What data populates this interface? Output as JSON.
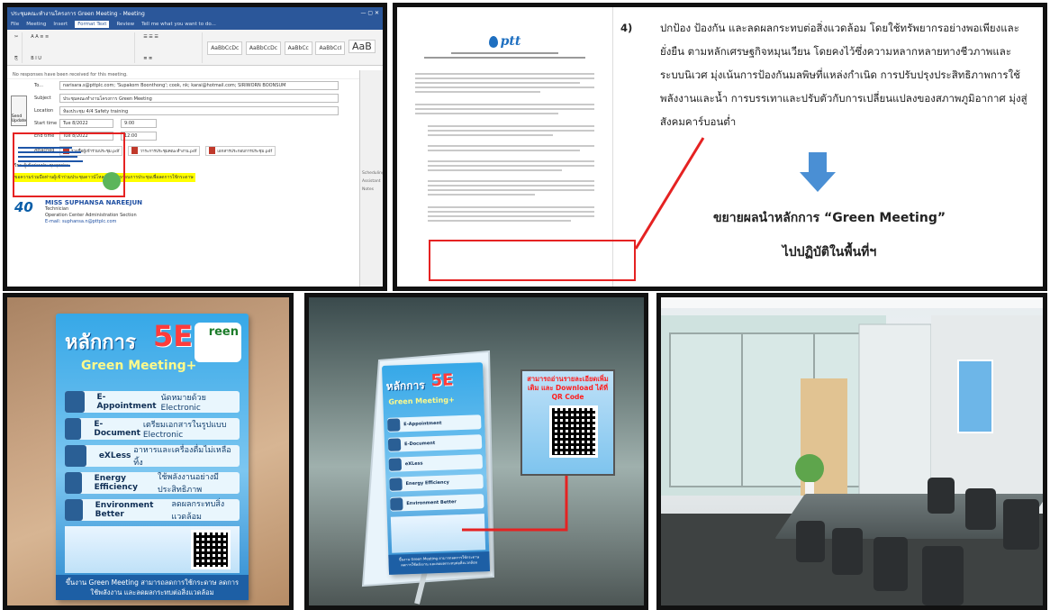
{
  "outlook": {
    "window_title": "ประชุมคณะทำงานโครงการ Green Meeting - Meeting",
    "menu_tabs": [
      "File",
      "Meeting",
      "Insert",
      "Format Text",
      "Review",
      "Tell me what you want to do..."
    ],
    "active_tab": "Format Text",
    "ribbon_styles": [
      "AaBbCcDc",
      "AaBbCcDc",
      "AaBbCc",
      "AaBbCcI",
      "AaB"
    ],
    "notice": "No responses have been received for this meeting.",
    "to_label": "To...",
    "to_value": "narisara.s@pttplc.com; 'Supakorn Boonthong'; cook, nk; karai@hotmail.com; SIRIWORN BOONSUM",
    "subject_label": "Subject",
    "subject_value": "ประชุมคณะทำงานโครงการ Green Meeting",
    "location_label": "Location",
    "location_value": "ห้องประชุม 4/4 Safety training",
    "start_label": "Start time",
    "start_date": "Tue 8/2022",
    "start_time": "9:00",
    "end_label": "End time",
    "end_date": "Tue 8/2022",
    "end_time": "12:00",
    "attached_label": "Attached",
    "attachments": [
      "รายชื่อผู้เข้าร่วมประชุม.pdf",
      "วาระการประชุมคณะทำงาน.pdf",
      "เอกสารประกอบการประชุม.pdf"
    ],
    "send_label": "Send Update",
    "body_line": "เรียน ผู้เข้าร่วมประชุมทุกท่าน",
    "highlight": "ขอความร่วมมือท่านผู้เข้าร่วมประชุมดาวน์โหลดเอกสารก่อนการประชุมเพื่อลดการใช้กระดาษ",
    "side_labels": [
      "Scheduling",
      "Assistant",
      "Notes"
    ],
    "sig_name": "MISS SUPHANSA NAREEJUN",
    "sig_role": "Technician",
    "sig_dept": "Operation Center Administration Section",
    "sig_email": "E-mail: suphansa.n@pttplc.com",
    "sig_logo": "40"
  },
  "document": {
    "logo_text": "ptt",
    "item_number": "4)",
    "item_text": "ปกป้อง ป้องกัน และลดผลกระทบต่อสิ่งแวดล้อม โดยใช้ทรัพยากรอย่างพอเพียงและยั่งยืน ตามหลักเศรษฐกิจหมุนเวียน โดยคงไว้ซึ่งความหลากหลายทางชีวภาพและระบบนิเวศ มุ่งเน้นการป้องกันมลพิษที่แหล่งกำเนิด การปรับปรุงประสิทธิภาพการใช้พลังงานและน้ำ การบรรเทาและปรับตัวกับการเปลี่ยนแปลงของสภาพภูมิอากาศ มุ่งสู่สังคมคาร์บอนต่ำ",
    "caption_line1": "ขยายผลนำหลักการ “Green Meeting”",
    "caption_line2": "ไปปฏิบัติในพื้นที่ฯ"
  },
  "poster": {
    "title": "หลักการ",
    "big": "5E",
    "subtitle": "Green Meeting+",
    "logo": "reen",
    "rows": [
      {
        "key": "E-Appointment",
        "desc": "นัดหมายด้วย Electronic"
      },
      {
        "key": "E-Document",
        "desc": "เตรียมเอกสารในรูปแบบ Electronic"
      },
      {
        "key": "eXLess",
        "desc": "อาหารและเครื่องดื่มไม่เหลือทิ้ง"
      },
      {
        "key": "Energy Efficiency",
        "desc": "ใช้พลังงานอย่างมีประสิทธิภาพ"
      },
      {
        "key": "Environment Better",
        "desc": "ลดผลกระทบสิ่งแวดล้อม"
      }
    ],
    "footer": "ขึ้นงาน Green Meeting สามารถลดการใช้กระดาษ ลดการใช้พลังงาน และลดผลกระทบต่อสิ่งแวดล้อม"
  },
  "qr_inset": {
    "text": "สามารถอ่านรายละเอียดเพิ่มเติม และ Download ได้ที่ QR Code"
  },
  "colors": {
    "frame": "#111111",
    "highlight_red": "#e52222",
    "outlook_blue": "#2b579a",
    "ptt_blue": "#1e6fc0",
    "arrow_blue": "#4a8fd4"
  }
}
